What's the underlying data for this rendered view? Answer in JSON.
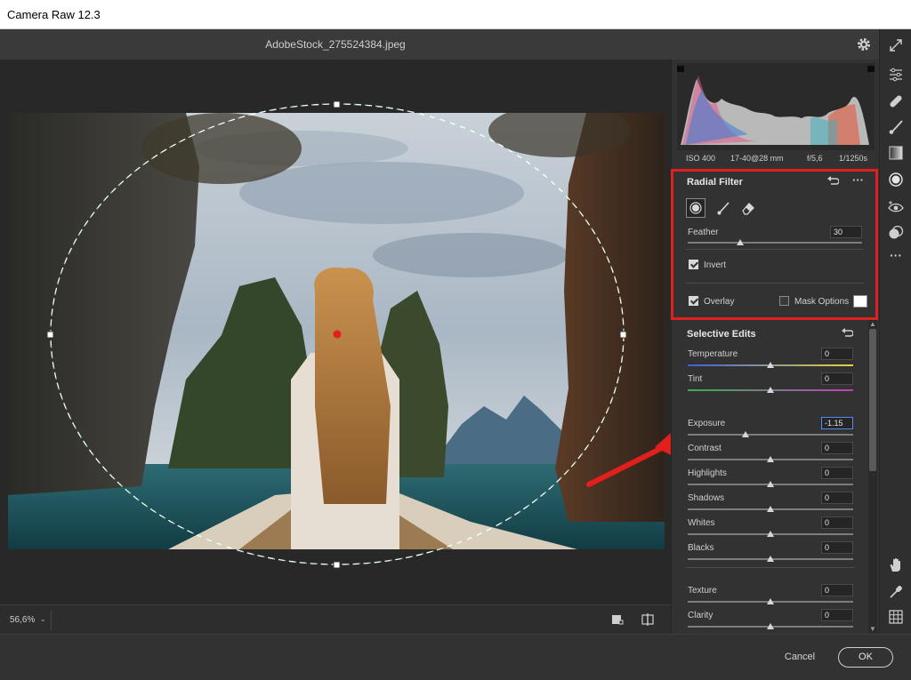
{
  "window": {
    "title": "Camera Raw 12.3"
  },
  "file": {
    "name": "AdobeStock_275524384.jpeg"
  },
  "histogram": {
    "iso": "ISO 400",
    "lens": "17-40@28 mm",
    "aperture": "f/5,6",
    "shutter": "1/1250s"
  },
  "radial_filter": {
    "title": "Radial Filter",
    "feather_label": "Feather",
    "feather_value": "30",
    "feather_level": 0.3,
    "invert_label": "Invert",
    "invert_checked": true,
    "overlay_label": "Overlay",
    "overlay_checked": true,
    "mask_options_label": "Mask Options",
    "mask_options_checked": false,
    "overlay_color": "#ffffff"
  },
  "selective_edits": {
    "title": "Selective Edits",
    "sliders": [
      {
        "label": "Temperature",
        "value": "0",
        "level": 0.5
      },
      {
        "label": "Tint",
        "value": "0",
        "level": 0.5
      },
      {
        "label": "Exposure",
        "value": "-1.15",
        "level": 0.35
      },
      {
        "label": "Contrast",
        "value": "0",
        "level": 0.5
      },
      {
        "label": "Highlights",
        "value": "0",
        "level": 0.5
      },
      {
        "label": "Shadows",
        "value": "0",
        "level": 0.5
      },
      {
        "label": "Whites",
        "value": "0",
        "level": 0.5
      },
      {
        "label": "Blacks",
        "value": "0",
        "level": 0.5
      },
      {
        "label": "Texture",
        "value": "0",
        "level": 0.5
      },
      {
        "label": "Clarity",
        "value": "0",
        "level": 0.5
      }
    ]
  },
  "bottom": {
    "zoom": "56,6%"
  },
  "footer": {
    "cancel": "Cancel",
    "ok": "OK"
  },
  "colors": {
    "highlight": "#e21f1f",
    "accent": "#4c8ef5"
  },
  "toolstrip": [
    "edit-icon",
    "healing-icon",
    "brush-icon",
    "graduated-filter-icon",
    "radial-filter-icon",
    "red-eye-icon",
    "presets-icon",
    "more-icon",
    "hand-icon",
    "eyedropper-icon",
    "grid-icon"
  ]
}
